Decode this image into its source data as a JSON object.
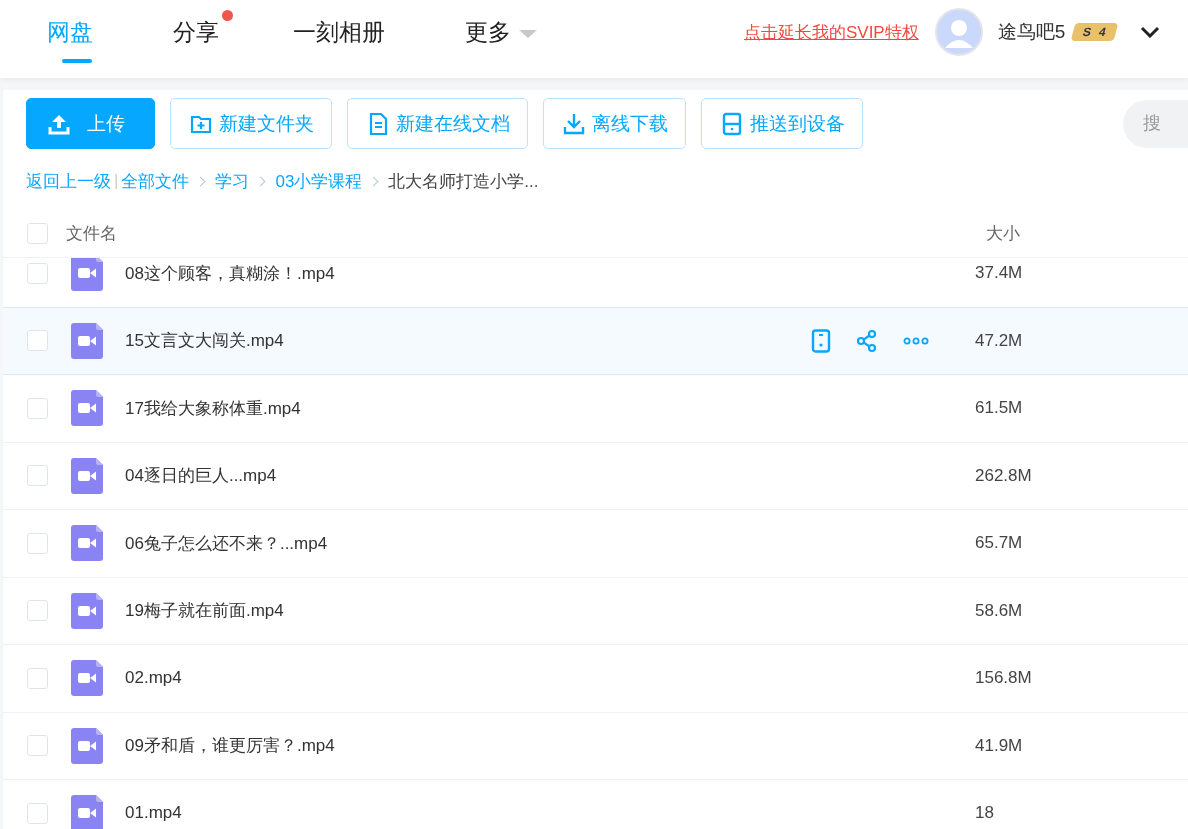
{
  "nav": {
    "tabs": [
      {
        "label": "网盘",
        "selected": true,
        "dot": false,
        "caret": false
      },
      {
        "label": "分享",
        "selected": false,
        "dot": true,
        "caret": false
      },
      {
        "label": "一刻相册",
        "selected": false,
        "dot": false,
        "caret": false
      },
      {
        "label": "更多",
        "selected": false,
        "dot": false,
        "caret": true
      }
    ],
    "promo_link": "点击延长我的SVIP特权",
    "user": {
      "name": "途鸟吧5",
      "badge_letter": "S",
      "badge_level": "4"
    }
  },
  "toolbar": {
    "buttons": [
      {
        "label": "上传",
        "kind": "upload"
      },
      {
        "label": "新建文件夹",
        "kind": "folder"
      },
      {
        "label": "新建在线文档",
        "kind": "doc"
      },
      {
        "label": "离线下载",
        "kind": "download"
      },
      {
        "label": "推送到设备",
        "kind": "device"
      }
    ],
    "search": {
      "placeholder": "搜"
    }
  },
  "breadcrumb": {
    "back": "返回上一级",
    "divider": "|",
    "items": [
      "全部文件",
      "学习",
      "03小学课程"
    ],
    "current": "北大名师打造小学..."
  },
  "table": {
    "columns": [
      "文件名",
      "大小"
    ],
    "all_checked": false,
    "rows": [
      {
        "name": "08这个顾客，真糊涂！.mp4",
        "size": "37.4M",
        "checked": false,
        "hovered": false
      },
      {
        "name": "15文言文大闯关.mp4",
        "size": "47.2M",
        "checked": false,
        "hovered": true
      },
      {
        "name": "17我给大象称体重.mp4",
        "size": "61.5M",
        "checked": false,
        "hovered": false
      },
      {
        "name": "04逐日的巨人...mp4",
        "size": "262.8M",
        "checked": false,
        "hovered": false
      },
      {
        "name": "06兔子怎么还不来？...mp4",
        "size": "65.7M",
        "checked": false,
        "hovered": false
      },
      {
        "name": "19梅子就在前面.mp4",
        "size": "58.6M",
        "checked": false,
        "hovered": false
      },
      {
        "name": "02.mp4",
        "size": "156.8M",
        "checked": false,
        "hovered": false
      },
      {
        "name": "09矛和盾，谁更厉害？.mp4",
        "size": "41.9M",
        "checked": false,
        "hovered": false
      },
      {
        "name": "01.mp4",
        "size": "18",
        "checked": false,
        "hovered": false
      }
    ]
  }
}
